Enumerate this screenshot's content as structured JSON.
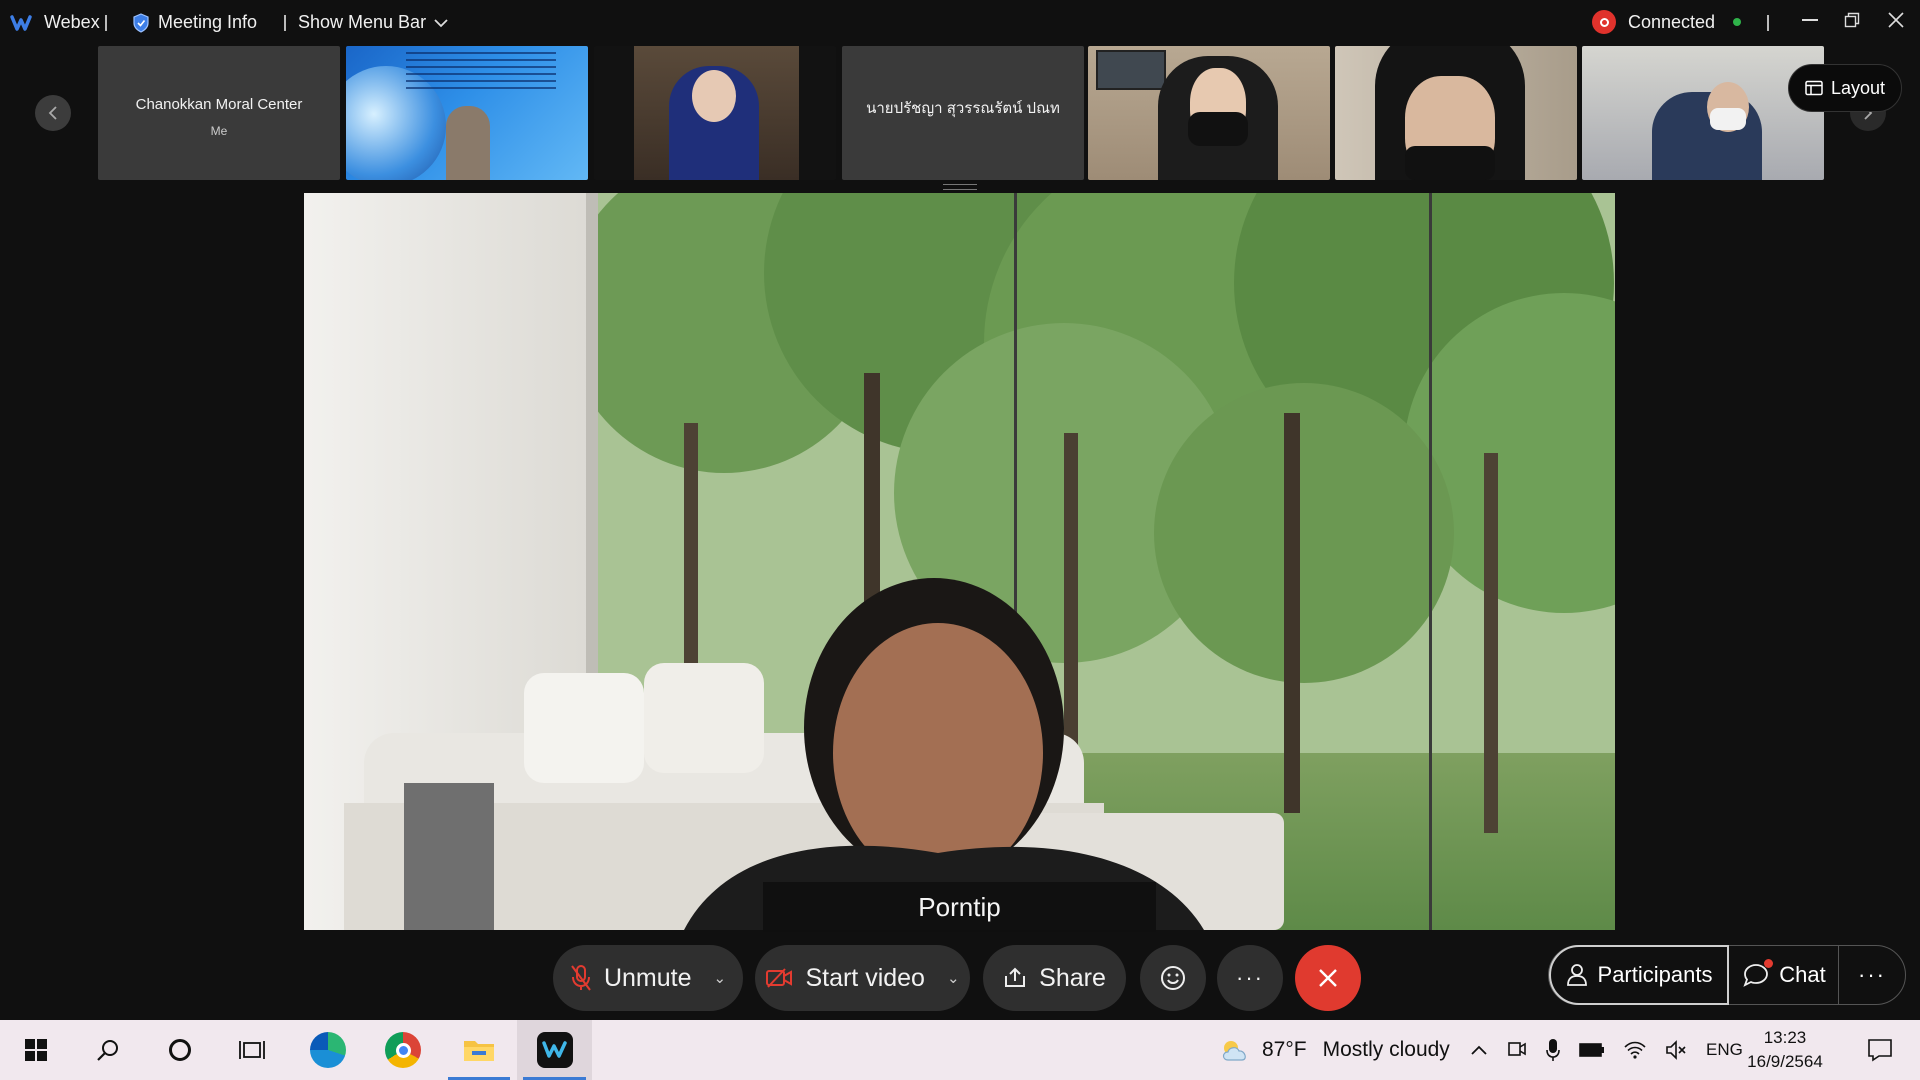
{
  "topbar": {
    "app_name": "Webex",
    "meeting_info": "Meeting Info",
    "show_menu_bar": "Show Menu Bar",
    "status": "Connected"
  },
  "participants_strip": {
    "tiles": [
      {
        "name": "Chanokkan Moral Center",
        "sub": "Me",
        "type": "name"
      },
      {
        "name": "",
        "type": "video"
      },
      {
        "name": "",
        "type": "video"
      },
      {
        "name": "นายปรัชญา สุวรรณรัตน์ ปณท",
        "type": "name"
      },
      {
        "name": "",
        "type": "video"
      },
      {
        "name": "",
        "type": "video"
      },
      {
        "name": "",
        "type": "video"
      }
    ],
    "layout_label": "Layout"
  },
  "stage": {
    "speaker_name": "Porntip"
  },
  "controls": {
    "unmute": "Unmute",
    "start_video": "Start video",
    "share": "Share",
    "participants": "Participants",
    "chat": "Chat"
  },
  "taskbar": {
    "temperature": "87°F",
    "weather": "Mostly cloudy",
    "language": "ENG",
    "time": "13:23",
    "date": "16/9/2564"
  },
  "colors": {
    "end_call": "#e03a2f",
    "status_red": "#e0322c",
    "status_green": "#2fb34a",
    "shield_blue": "#3d7ee6"
  }
}
